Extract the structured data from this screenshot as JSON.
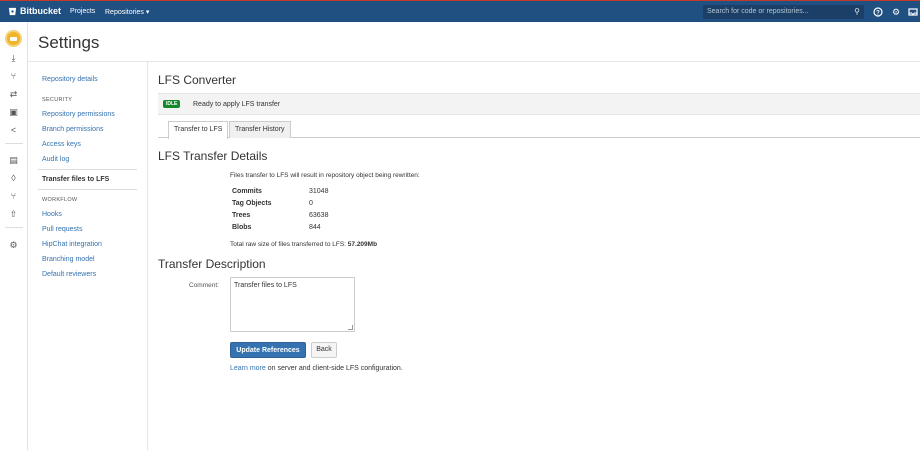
{
  "header": {
    "brand": "Bitbucket",
    "nav_projects": "Projects",
    "nav_repositories": "Repositories ▾",
    "search_placeholder": "Search for code or repositories..."
  },
  "page": {
    "title": "Settings"
  },
  "sidebar": {
    "repo_details": "Repository details",
    "security_heading": "SECURITY",
    "security_items": [
      "Repository permissions",
      "Branch permissions",
      "Access keys",
      "Audit log"
    ],
    "active_item": "Transfer files to LFS",
    "workflow_heading": "WORKFLOW",
    "workflow_items": [
      "Hooks",
      "Pull requests",
      "HipChat integration",
      "Branching model",
      "Default reviewers"
    ]
  },
  "lfs": {
    "heading": "LFS Converter",
    "status_badge": "IDLE",
    "status_text": "Ready to apply LFS transfer",
    "tabs": [
      "Transfer to LFS",
      "Transfer History"
    ],
    "details_heading": "LFS Transfer Details",
    "details_intro": "Files transfer to LFS will result in repository object being rewritten:",
    "stats": [
      {
        "label": "Commits",
        "value": "31048"
      },
      {
        "label": "Tag Objects",
        "value": "0"
      },
      {
        "label": "Trees",
        "value": "63638"
      },
      {
        "label": "Blobs",
        "value": "844"
      }
    ],
    "total_prefix": "Total raw size of files transferred to LFS: ",
    "total_value": "57.209Mb",
    "desc_heading": "Transfer Description",
    "comment_label": "Comment:",
    "comment_value": "Transfer files to LFS",
    "update_button": "Update References",
    "back_button": "Back",
    "learn_more_link": "Learn more",
    "learn_more_rest": " on server and client-side LFS configuration."
  }
}
